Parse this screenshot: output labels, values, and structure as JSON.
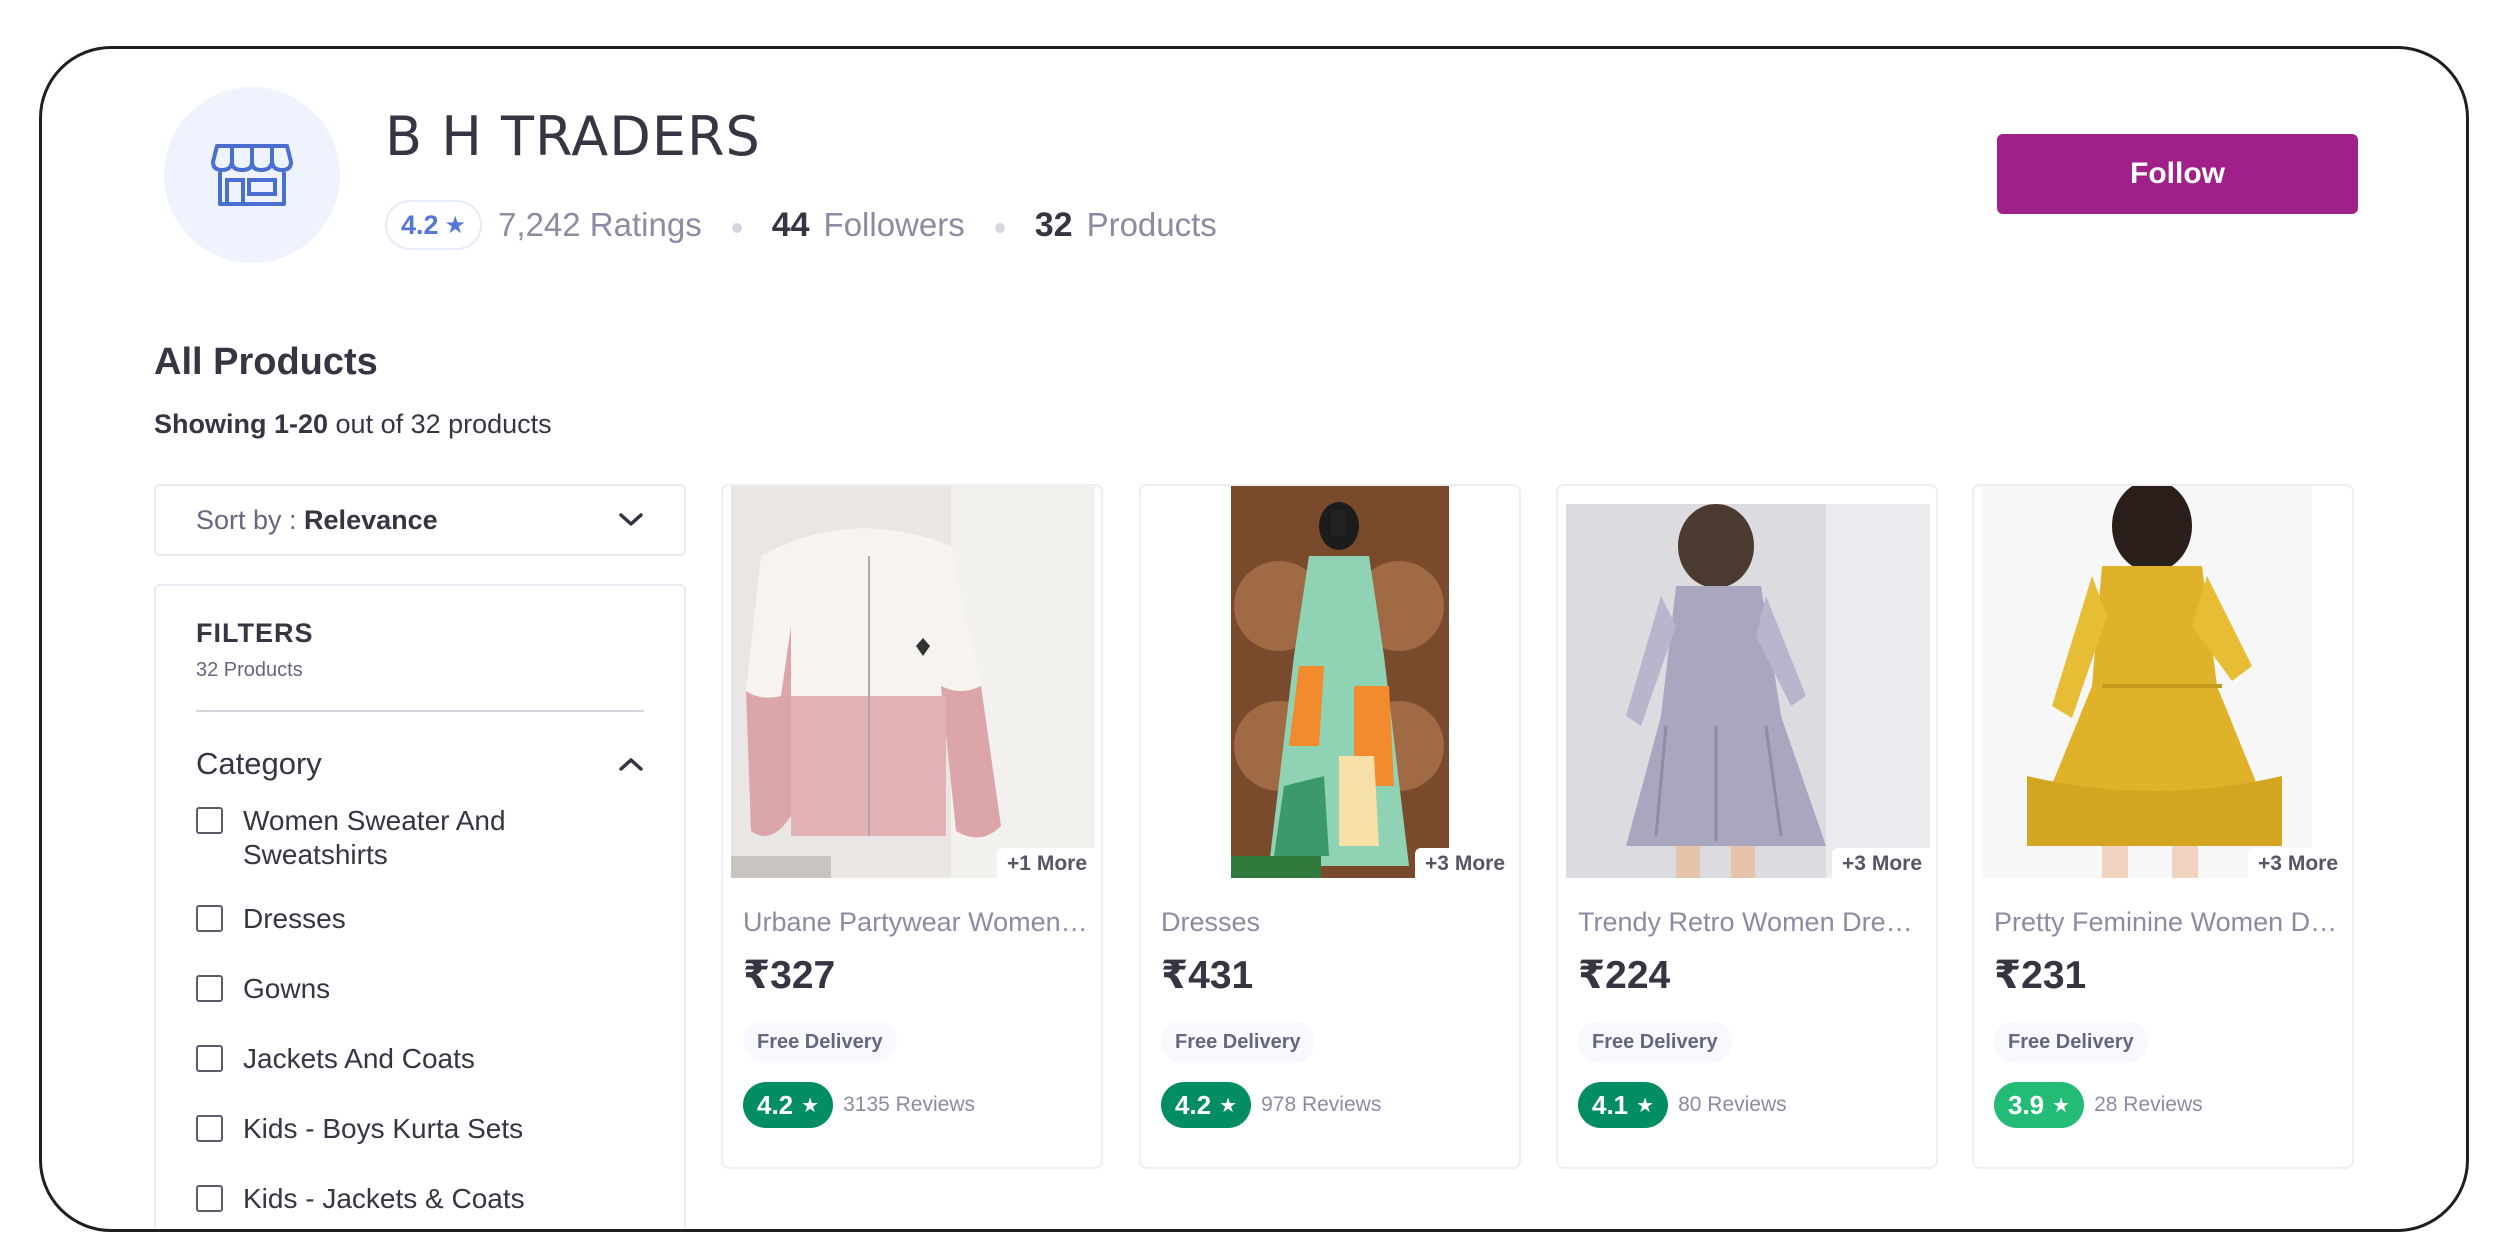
{
  "store": {
    "name": "B H TRADERS",
    "rating": "4.2",
    "ratings_count": "7,242 Ratings",
    "followers_count": "44",
    "followers_label": "Followers",
    "products_count": "32",
    "products_label": "Products",
    "follow_label": "Follow"
  },
  "section": {
    "title": "All Products",
    "showing_range": "Showing 1-20",
    "showing_rest": " out of 32 products"
  },
  "sort": {
    "label": "Sort by : ",
    "value": "Relevance"
  },
  "filters": {
    "title": "FILTERS",
    "count": "32 Products",
    "category_title": "Category",
    "categories": [
      "Women Sweater And Sweatshirts",
      "Dresses",
      "Gowns",
      "Jackets And Coats",
      "Kids - Boys Kurta Sets",
      "Kids - Jackets & Coats"
    ]
  },
  "products": [
    {
      "title": "Urbane Partywear Women Jackets",
      "price": "₹327",
      "more": "+1 More",
      "delivery": "Free Delivery",
      "rating": "4.2",
      "reviews": "3135 Reviews",
      "rating_color": "#038d63"
    },
    {
      "title": "Dresses",
      "price": "₹431",
      "more": "+3 More",
      "delivery": "Free Delivery",
      "rating": "4.2",
      "reviews": "978 Reviews",
      "rating_color": "#038d63"
    },
    {
      "title": "Trendy Retro Women Dresses",
      "price": "₹224",
      "more": "+3 More",
      "delivery": "Free Delivery",
      "rating": "4.1",
      "reviews": "80 Reviews",
      "rating_color": "#038d63"
    },
    {
      "title": "Pretty Feminine Women Dresses",
      "price": "₹231",
      "more": "+3 More",
      "delivery": "Free Delivery",
      "rating": "3.9",
      "reviews": "28 Reviews",
      "rating_color": "#23bb75"
    }
  ],
  "colors": {
    "accent": "#9f2089",
    "rating_blue": "#5677d6"
  },
  "icons": {
    "store": "store-icon",
    "star": "star-icon",
    "chevron_down": "chevron-down-icon",
    "chevron_up": "chevron-up-icon"
  }
}
